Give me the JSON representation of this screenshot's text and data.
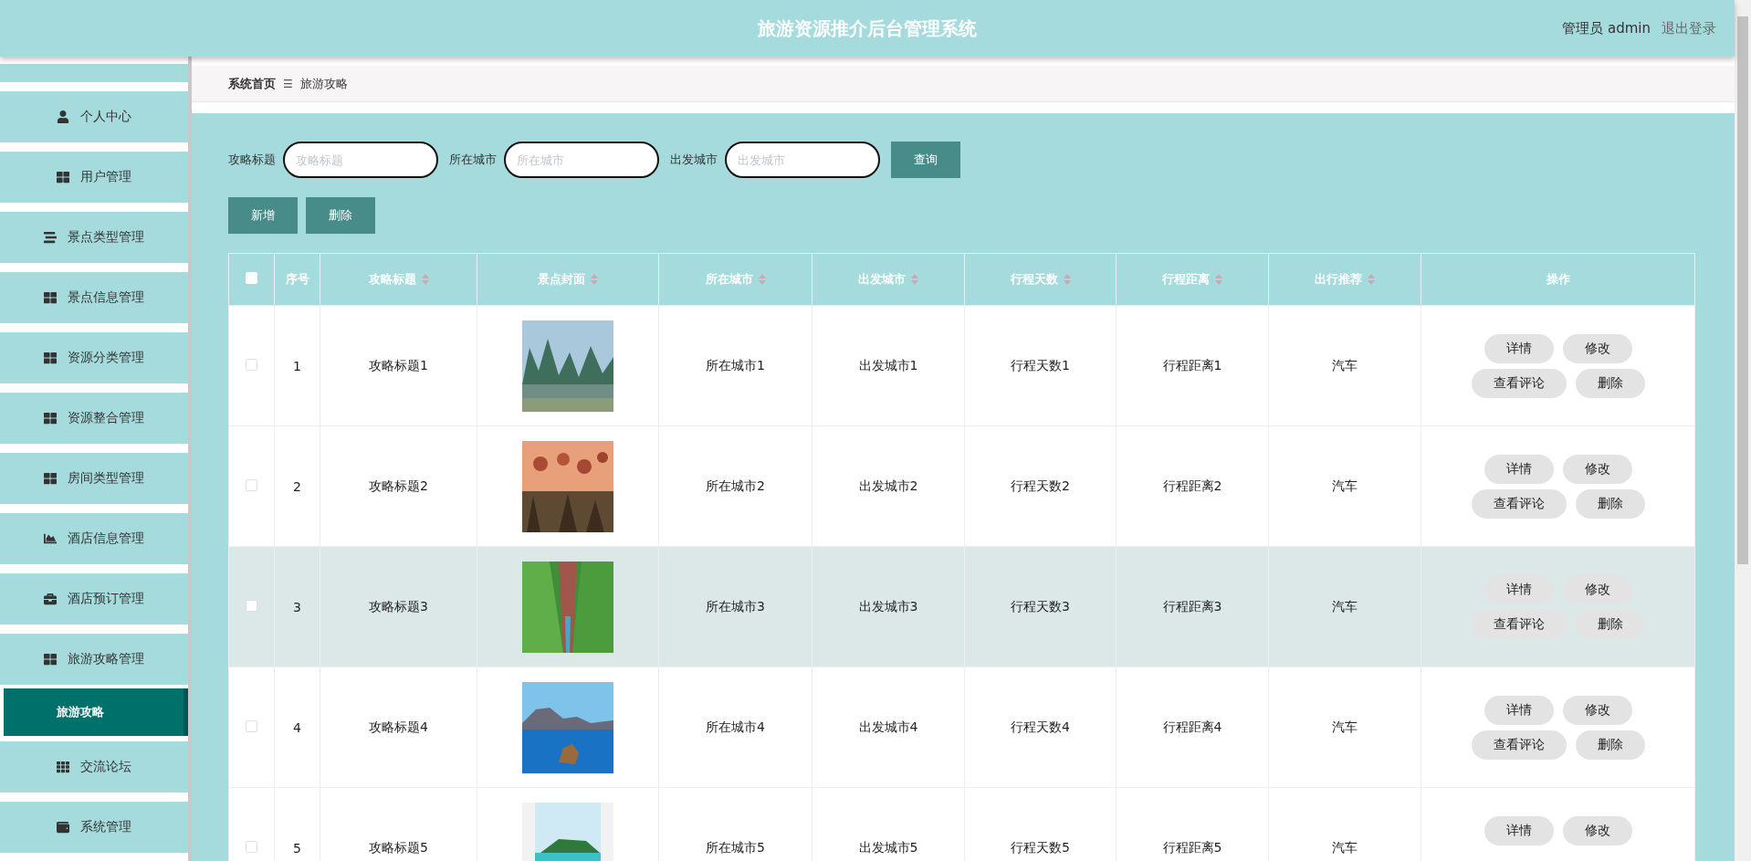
{
  "header": {
    "title": "旅游资源推介后台管理系统",
    "user": "管理员 admin",
    "logout": "退出登录"
  },
  "sidebar": {
    "items": [
      {
        "label": "个人中心"
      },
      {
        "label": "用户管理"
      },
      {
        "label": "景点类型管理"
      },
      {
        "label": "景点信息管理"
      },
      {
        "label": "资源分类管理"
      },
      {
        "label": "资源整合管理"
      },
      {
        "label": "房间类型管理"
      },
      {
        "label": "酒店信息管理"
      },
      {
        "label": "酒店预订管理"
      },
      {
        "label": "旅游攻略管理",
        "children": [
          {
            "label": "旅游攻略",
            "selected": true
          }
        ]
      },
      {
        "label": "交流论坛"
      },
      {
        "label": "系统管理"
      }
    ]
  },
  "breadcrumb": {
    "items": [
      "系统首页",
      "旅游攻略"
    ],
    "separator": "☰"
  },
  "search": {
    "fields": [
      {
        "label": "攻略标题",
        "placeholder": "攻略标题"
      },
      {
        "label": "所在城市",
        "placeholder": "所在城市"
      },
      {
        "label": "出发城市",
        "placeholder": "出发城市"
      }
    ],
    "button": "查询"
  },
  "actions": [
    "新增",
    "删除"
  ],
  "table": {
    "header_checked": false,
    "columns": [
      {
        "label": "序号",
        "sortable": false
      },
      {
        "label": "攻略标题",
        "sortable": true
      },
      {
        "label": "景点封面",
        "sortable": true
      },
      {
        "label": "所在城市",
        "sortable": true
      },
      {
        "label": "出发城市",
        "sortable": true
      },
      {
        "label": "行程天数",
        "sortable": true
      },
      {
        "label": "行程距离",
        "sortable": true
      },
      {
        "label": "出行推荐",
        "sortable": true
      },
      {
        "label": "操作",
        "sortable": false
      }
    ],
    "rows": [
      {
        "checked": false,
        "highlighted": false,
        "index": "1",
        "title": "攻略标题1",
        "cover": {
          "kind": "picture"
        },
        "city": "所在城市1",
        "from": "出发城市1",
        "days": "行程天数1",
        "distance": "行程距离1",
        "transport": "汽车",
        "buttons": [
          "详情",
          "修改",
          "查看评论",
          "删除"
        ]
      },
      {
        "checked": false,
        "highlighted": false,
        "index": "2",
        "title": "攻略标题2",
        "cover": {
          "kind": "picture"
        },
        "city": "所在城市2",
        "from": "出发城市2",
        "days": "行程天数2",
        "distance": "行程距离2",
        "transport": "汽车",
        "buttons": [
          "详情",
          "修改",
          "查看评论",
          "删除"
        ]
      },
      {
        "checked": false,
        "highlighted": true,
        "index": "3",
        "title": "攻略标题3",
        "cover": {
          "kind": "picture"
        },
        "city": "所在城市3",
        "from": "出发城市3",
        "days": "行程天数3",
        "distance": "行程距离3",
        "transport": "汽车",
        "buttons": [
          "详情",
          "修改",
          "查看评论",
          "删除"
        ]
      },
      {
        "checked": false,
        "highlighted": false,
        "index": "4",
        "title": "攻略标题4",
        "cover": {
          "kind": "picture"
        },
        "city": "所在城市4",
        "from": "出发城市4",
        "days": "行程天数4",
        "distance": "行程距离4",
        "transport": "汽车",
        "buttons": [
          "详情",
          "修改",
          "查看评论",
          "删除"
        ]
      },
      {
        "checked": false,
        "highlighted": false,
        "index": "5",
        "title": "攻略标题5",
        "cover": {
          "kind": "picture"
        },
        "city": "所在城市5",
        "from": "出发城市5",
        "days": "行程天数5",
        "distance": "行程距离5",
        "transport": "汽车",
        "buttons": [
          "详情",
          "修改"
        ]
      }
    ]
  }
}
